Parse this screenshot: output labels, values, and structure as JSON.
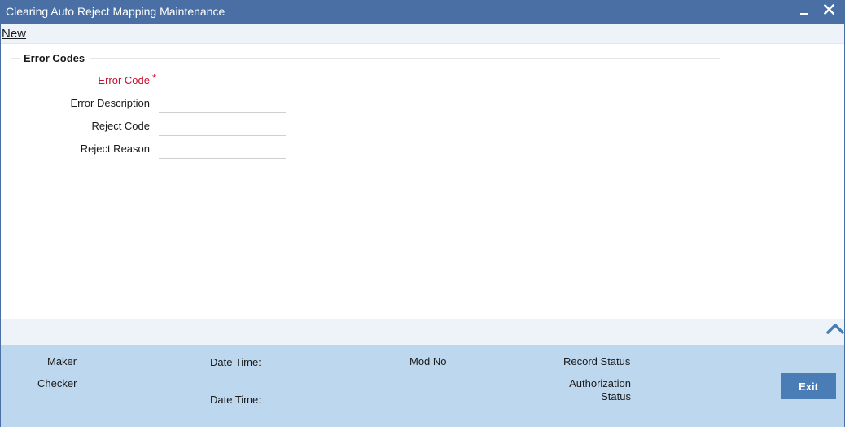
{
  "window": {
    "title": "Clearing Auto Reject Mapping Maintenance"
  },
  "toolbar": {
    "new_label": "New"
  },
  "section": {
    "title": "Error Codes"
  },
  "fields": [
    {
      "label": "Error Code",
      "required": true,
      "value": ""
    },
    {
      "label": "Error Description",
      "required": false,
      "value": ""
    },
    {
      "label": "Reject Code",
      "required": false,
      "value": ""
    },
    {
      "label": "Reject Reason",
      "required": false,
      "value": ""
    }
  ],
  "required_marker": "*",
  "footer": {
    "maker_label": "Maker",
    "checker_label": "Checker",
    "date_time_label_1": "Date Time:",
    "date_time_label_2": "Date Time:",
    "mod_no_label": "Mod No",
    "record_status_label": "Record Status",
    "authorization_label": "Authorization",
    "status_label": "Status",
    "exit_label": "Exit"
  },
  "icons": {
    "minimize": "minimize-icon",
    "close": "close-icon",
    "collapse": "chevron-up-icon"
  },
  "colors": {
    "titlebar": "#4a6fa5",
    "footer": "#bdd7ee",
    "exit_button": "#4a7db5",
    "required": "#c8102e"
  }
}
